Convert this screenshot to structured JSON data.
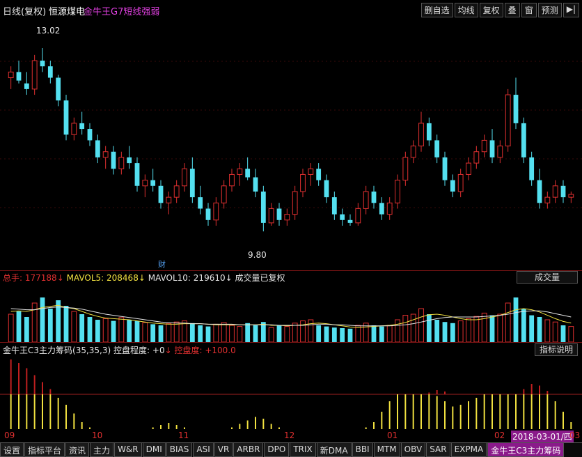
{
  "header": {
    "title": "日线(复权)",
    "stock": "恒源煤电",
    "indicator": "金牛王G7短线强弱",
    "buttons": [
      "删自选",
      "均线",
      "复权",
      "叠",
      "窗",
      "预测"
    ],
    "arrow_icon": "exit-arrow-icon"
  },
  "main_chart": {
    "high_label": "13.02",
    "low_label": "9.80",
    "event_label": "财",
    "ylim": [
      9.3,
      13.4
    ]
  },
  "volume_panel": {
    "total_label": "总手:",
    "total_value": "177188",
    "total_arrow": "↓",
    "mavol5_label": "MAVOL5:",
    "mavol5_value": "208468",
    "mavol5_arrow": "↓",
    "mavol10_label": "MAVOL10:",
    "mavol10_value": "219610",
    "mavol10_arrow": "↓",
    "note": "成交量已复权",
    "selector": "成交量"
  },
  "indicator_panel": {
    "name": "金牛王C3主力筹码(35,35,3)",
    "control_label": "控盘程度:",
    "control_value": "+0",
    "control_arrow": "↓",
    "control2_label": "控盘度:",
    "control2_value": "+100.0",
    "help_button": "指标说明"
  },
  "x_axis": [
    "09",
    "10",
    "11",
    "12",
    "01",
    "02",
    "03"
  ],
  "date_badge": "2018-03-01/四",
  "tabs": [
    "设置",
    "指标平台",
    "资讯",
    "主力",
    "W&R",
    "DMI",
    "BIAS",
    "ASI",
    "VR",
    "ARBR",
    "DPO",
    "TRIX",
    "新DMA",
    "BBI",
    "MTM",
    "OBV",
    "SAR",
    "EXPMA",
    "金牛王C3主力筹码"
  ],
  "active_tab": "金牛王C3主力筹码",
  "colors": {
    "up": "#e03030",
    "down": "#54e0f0",
    "ma": "#e6e6e6",
    "yellow": "#f0e040",
    "red_fill": "#c02020"
  },
  "chart_data": {
    "type": "candlestick",
    "candles": [
      [
        12.5,
        12.7,
        12.3,
        12.6
      ],
      [
        12.6,
        12.8,
        12.4,
        12.45
      ],
      [
        12.4,
        12.6,
        12.2,
        12.3
      ],
      [
        12.3,
        12.9,
        12.2,
        12.8
      ],
      [
        12.8,
        13.02,
        12.6,
        12.7
      ],
      [
        12.7,
        12.8,
        12.4,
        12.5
      ],
      [
        12.5,
        12.55,
        12.0,
        12.1
      ],
      [
        12.1,
        12.2,
        11.4,
        11.5
      ],
      [
        11.5,
        11.8,
        11.4,
        11.7
      ],
      [
        11.7,
        11.9,
        11.5,
        11.6
      ],
      [
        11.6,
        11.7,
        11.3,
        11.4
      ],
      [
        11.4,
        11.5,
        11.0,
        11.1
      ],
      [
        11.1,
        11.3,
        10.9,
        11.2
      ],
      [
        11.2,
        11.3,
        10.8,
        10.9
      ],
      [
        10.9,
        11.2,
        10.8,
        11.1
      ],
      [
        11.1,
        11.3,
        10.9,
        11.0
      ],
      [
        11.0,
        11.1,
        10.5,
        10.6
      ],
      [
        10.6,
        10.8,
        10.4,
        10.7
      ],
      [
        10.7,
        10.9,
        10.5,
        10.6
      ],
      [
        10.6,
        10.7,
        10.2,
        10.3
      ],
      [
        10.3,
        10.5,
        10.1,
        10.4
      ],
      [
        10.4,
        10.7,
        10.3,
        10.6
      ],
      [
        10.6,
        11.0,
        10.5,
        10.9
      ],
      [
        10.9,
        11.1,
        10.3,
        10.4
      ],
      [
        10.4,
        10.6,
        10.1,
        10.2
      ],
      [
        10.2,
        10.3,
        9.9,
        10.0
      ],
      [
        10.0,
        10.4,
        9.9,
        10.3
      ],
      [
        10.3,
        10.7,
        10.2,
        10.6
      ],
      [
        10.6,
        10.9,
        10.5,
        10.8
      ],
      [
        10.8,
        11.0,
        10.6,
        10.9
      ],
      [
        10.9,
        11.1,
        10.7,
        10.75
      ],
      [
        10.75,
        10.9,
        10.4,
        10.5
      ],
      [
        10.5,
        10.6,
        9.8,
        9.95
      ],
      [
        9.95,
        10.3,
        9.9,
        10.2
      ],
      [
        10.2,
        10.3,
        9.9,
        10.0
      ],
      [
        10.0,
        10.2,
        9.9,
        10.1
      ],
      [
        10.1,
        10.6,
        10.0,
        10.5
      ],
      [
        10.5,
        10.9,
        10.4,
        10.8
      ],
      [
        10.8,
        11.0,
        10.6,
        10.9
      ],
      [
        10.9,
        11.0,
        10.6,
        10.7
      ],
      [
        10.7,
        10.8,
        10.3,
        10.4
      ],
      [
        10.4,
        10.5,
        10.0,
        10.1
      ],
      [
        10.1,
        10.2,
        9.9,
        10.0
      ],
      [
        10.0,
        10.1,
        9.9,
        9.95
      ],
      [
        9.95,
        10.3,
        9.9,
        10.2
      ],
      [
        10.2,
        10.6,
        10.1,
        10.5
      ],
      [
        10.5,
        10.6,
        10.2,
        10.3
      ],
      [
        10.3,
        10.4,
        10.0,
        10.1
      ],
      [
        10.1,
        10.4,
        10.0,
        10.3
      ],
      [
        10.3,
        10.8,
        10.2,
        10.7
      ],
      [
        10.7,
        11.2,
        10.6,
        11.1
      ],
      [
        11.1,
        11.4,
        11.0,
        11.3
      ],
      [
        11.3,
        11.9,
        11.2,
        11.7
      ],
      [
        11.7,
        11.8,
        11.3,
        11.4
      ],
      [
        11.4,
        11.5,
        11.0,
        11.1
      ],
      [
        11.1,
        11.2,
        10.6,
        10.7
      ],
      [
        10.7,
        10.8,
        10.4,
        10.5
      ],
      [
        10.5,
        10.9,
        10.4,
        10.8
      ],
      [
        10.8,
        11.1,
        10.7,
        11.0
      ],
      [
        11.0,
        11.3,
        10.9,
        11.2
      ],
      [
        11.2,
        11.5,
        11.1,
        11.4
      ],
      [
        11.4,
        11.6,
        11.0,
        11.1
      ],
      [
        11.1,
        11.4,
        11.0,
        11.3
      ],
      [
        11.3,
        12.3,
        11.2,
        12.2
      ],
      [
        12.2,
        12.5,
        11.6,
        11.7
      ],
      [
        11.7,
        11.8,
        11.0,
        11.1
      ],
      [
        11.1,
        11.2,
        10.6,
        10.7
      ],
      [
        10.7,
        10.9,
        10.2,
        10.3
      ],
      [
        10.3,
        10.5,
        10.2,
        10.4
      ],
      [
        10.4,
        10.7,
        10.3,
        10.6
      ],
      [
        10.6,
        10.7,
        10.3,
        10.4
      ],
      [
        10.4,
        10.5,
        10.3,
        10.45
      ]
    ],
    "volume_max": 100,
    "volumes": [
      50,
      55,
      45,
      70,
      80,
      60,
      75,
      65,
      55,
      50,
      45,
      40,
      42,
      38,
      44,
      40,
      38,
      35,
      32,
      30,
      33,
      36,
      38,
      34,
      30,
      28,
      32,
      35,
      30,
      28,
      34,
      30,
      36,
      26,
      30,
      28,
      34,
      38,
      40,
      30,
      28,
      26,
      25,
      24,
      30,
      34,
      30,
      28,
      30,
      40,
      48,
      50,
      60,
      50,
      40,
      36,
      34,
      38,
      42,
      46,
      52,
      48,
      50,
      70,
      80,
      60,
      48,
      45,
      40,
      36,
      30,
      28
    ],
    "mavol5": [
      55,
      56,
      55,
      58,
      62,
      64,
      66,
      62,
      60,
      55,
      50,
      46,
      43,
      42,
      41,
      40,
      38,
      36,
      34,
      33,
      32,
      32,
      33,
      33,
      33,
      32,
      31,
      31,
      31,
      31,
      31,
      31,
      32,
      30,
      30,
      29,
      30,
      31,
      33,
      34,
      33,
      31,
      29,
      27,
      26,
      27,
      28,
      29,
      30,
      32,
      35,
      40,
      45,
      49,
      50,
      48,
      45,
      42,
      40,
      40,
      42,
      45,
      48,
      53,
      58,
      60,
      58,
      54,
      48,
      42,
      37,
      34
    ],
    "mavol10": [
      60,
      59,
      58,
      58,
      60,
      62,
      63,
      62,
      61,
      59,
      56,
      53,
      50,
      48,
      46,
      44,
      42,
      40,
      38,
      36,
      35,
      34,
      34,
      33,
      33,
      32,
      32,
      32,
      32,
      31,
      31,
      31,
      31,
      31,
      30,
      30,
      30,
      30,
      31,
      32,
      32,
      31,
      31,
      30,
      29,
      29,
      29,
      29,
      29,
      30,
      31,
      33,
      36,
      39,
      42,
      44,
      45,
      45,
      45,
      45,
      46,
      47,
      48,
      50,
      53,
      55,
      56,
      56,
      54,
      51,
      48,
      45
    ],
    "c3_red": [
      100,
      90,
      75,
      55,
      35,
      15,
      0,
      0,
      0,
      0,
      0,
      0,
      0,
      0,
      0,
      0,
      0,
      0,
      0,
      0,
      0,
      0,
      0,
      0,
      0,
      0,
      0,
      0,
      0,
      0,
      0,
      0,
      0,
      0,
      0,
      0,
      0,
      0,
      0,
      0,
      0,
      0,
      0,
      0,
      0,
      0,
      0,
      0,
      0,
      0,
      0,
      0,
      0,
      5,
      12,
      8,
      0,
      0,
      0,
      0,
      0,
      0,
      0,
      0,
      0,
      15,
      30,
      25,
      10,
      0,
      0,
      0
    ],
    "c3_yellow": [
      100,
      100,
      100,
      100,
      100,
      100,
      90,
      70,
      45,
      20,
      5,
      0,
      0,
      0,
      0,
      0,
      0,
      0,
      5,
      12,
      18,
      12,
      5,
      0,
      0,
      0,
      0,
      0,
      5,
      15,
      25,
      35,
      30,
      15,
      5,
      0,
      0,
      0,
      0,
      0,
      0,
      0,
      0,
      0,
      0,
      5,
      20,
      50,
      80,
      100,
      100,
      100,
      100,
      100,
      95,
      80,
      65,
      70,
      80,
      90,
      100,
      100,
      100,
      100,
      100,
      100,
      100,
      100,
      100,
      80,
      50,
      20
    ]
  }
}
